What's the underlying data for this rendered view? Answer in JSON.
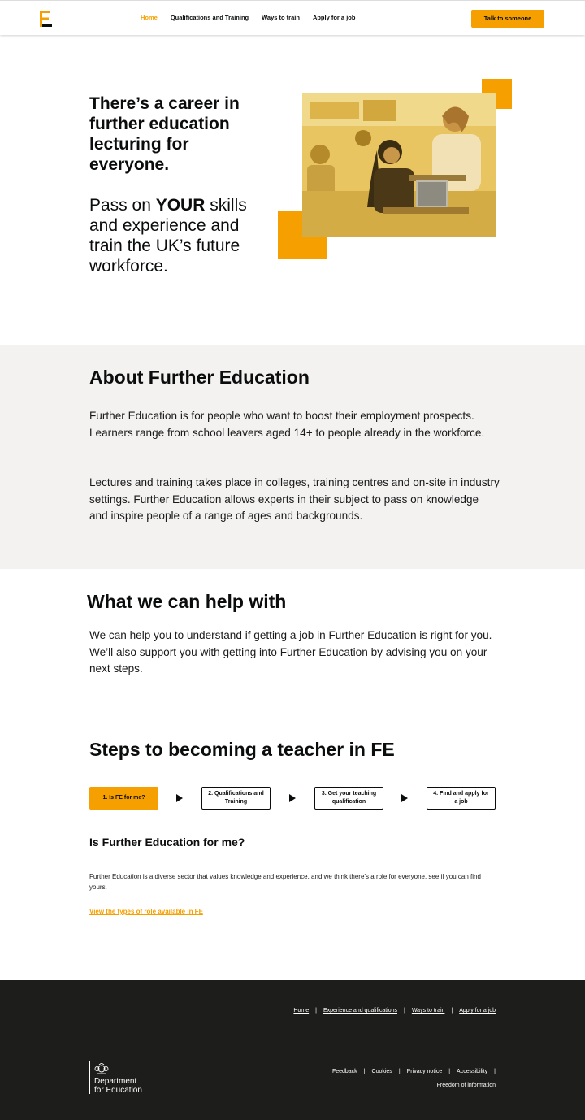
{
  "header": {
    "nav": [
      "Home",
      "Qualifications and Training",
      "Ways to train",
      "Apply for a job"
    ],
    "cta": "Talk to someone",
    "accent": "#f5a000"
  },
  "hero": {
    "title": "There’s a career in further education lecturing  for everyone.",
    "sub_pre": "Pass on ",
    "sub_bold": "YOUR",
    "sub_post": " skills and experience and train the UK’s future workforce."
  },
  "about": {
    "heading": "About Further Education",
    "p1": "Further Education is for people who want to boost their employment prospects. Learners range from school leavers aged 14+ to people already in the workforce.",
    "p2": "Lectures and training takes place in colleges, training centres and on-site in industry settings. Further Education allows experts in their subject to pass on knowledge and inspire people of a range of ages and backgrounds."
  },
  "help": {
    "heading": "What we can help with",
    "text": "We can help you to understand if getting a job in Further Education is right for you. We’ll also support you with getting into Further Education by advising you on your next steps."
  },
  "steps": {
    "heading": "Steps to becoming a teacher in FE",
    "items": [
      "1. Is FE for me?",
      "2. Qualifications and Training",
      "3. Get your teaching qualification",
      "4. Find and apply for a job"
    ],
    "section_heading": "Is Further Education for me?",
    "section_text": "Further Education is a diverse sector that values knowledge and experience, and we think there’s a role for everyone, see if you can find yours.",
    "link": "View the types of role available in FE"
  },
  "footer": {
    "top_links": [
      "Home",
      "Experience and qualifications",
      "Ways to train",
      "Apply for a job"
    ],
    "bottom_links": [
      "Feedback",
      "Cookies",
      "Privacy notice",
      "Accessibility"
    ],
    "foi": "Freedom of information",
    "dept_line1": "Department",
    "dept_line2": "for Education"
  }
}
